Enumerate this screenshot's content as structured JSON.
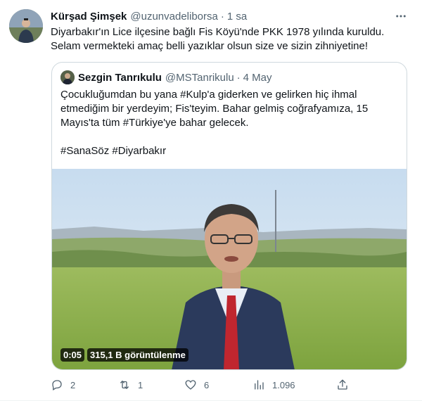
{
  "tweet": {
    "author_name": "Kürşad Şimşek",
    "author_handle": "@uzunvadeliborsa",
    "separator": "·",
    "time": "1 sa",
    "text_lines": [
      "Diyarbakır'ın Lice ilçesine bağlı Fis Köyü'nde PKK 1978 yılında kuruldu.",
      "Selam vermekteki amaç belli yazıklar olsun size ve sizin zihniyetine!"
    ]
  },
  "quote": {
    "author_name": "Sezgin Tanrıkulu",
    "author_handle": "@MSTanrikulu",
    "separator": "·",
    "time": "4 May",
    "text_lines": [
      "Çocukluğumdan bu yana #Kulp'a giderken ve gelirken hiç ihmal",
      "etmediğim bir yerdeyim; Fis'teyim. Bahar gelmiş coğrafyamıza, 15",
      "Mayıs'ta tüm #Türkiye'ye bahar gelecek."
    ],
    "hashtags": "#SanaSöz #Diyarbakır",
    "video": {
      "duration": "0:05",
      "views": "315,1 B görüntülenme"
    }
  },
  "actions": {
    "reply_count": "2",
    "retweet_count": "1",
    "like_count": "6",
    "views_count": "1.096"
  },
  "icons": {
    "more": "more-icon",
    "reply": "reply-icon",
    "retweet": "retweet-icon",
    "like": "like-icon",
    "views": "views-icon",
    "share": "share-icon"
  },
  "colors": {
    "text": "#0f1419",
    "secondary": "#536471",
    "border": "#cfd9de"
  }
}
